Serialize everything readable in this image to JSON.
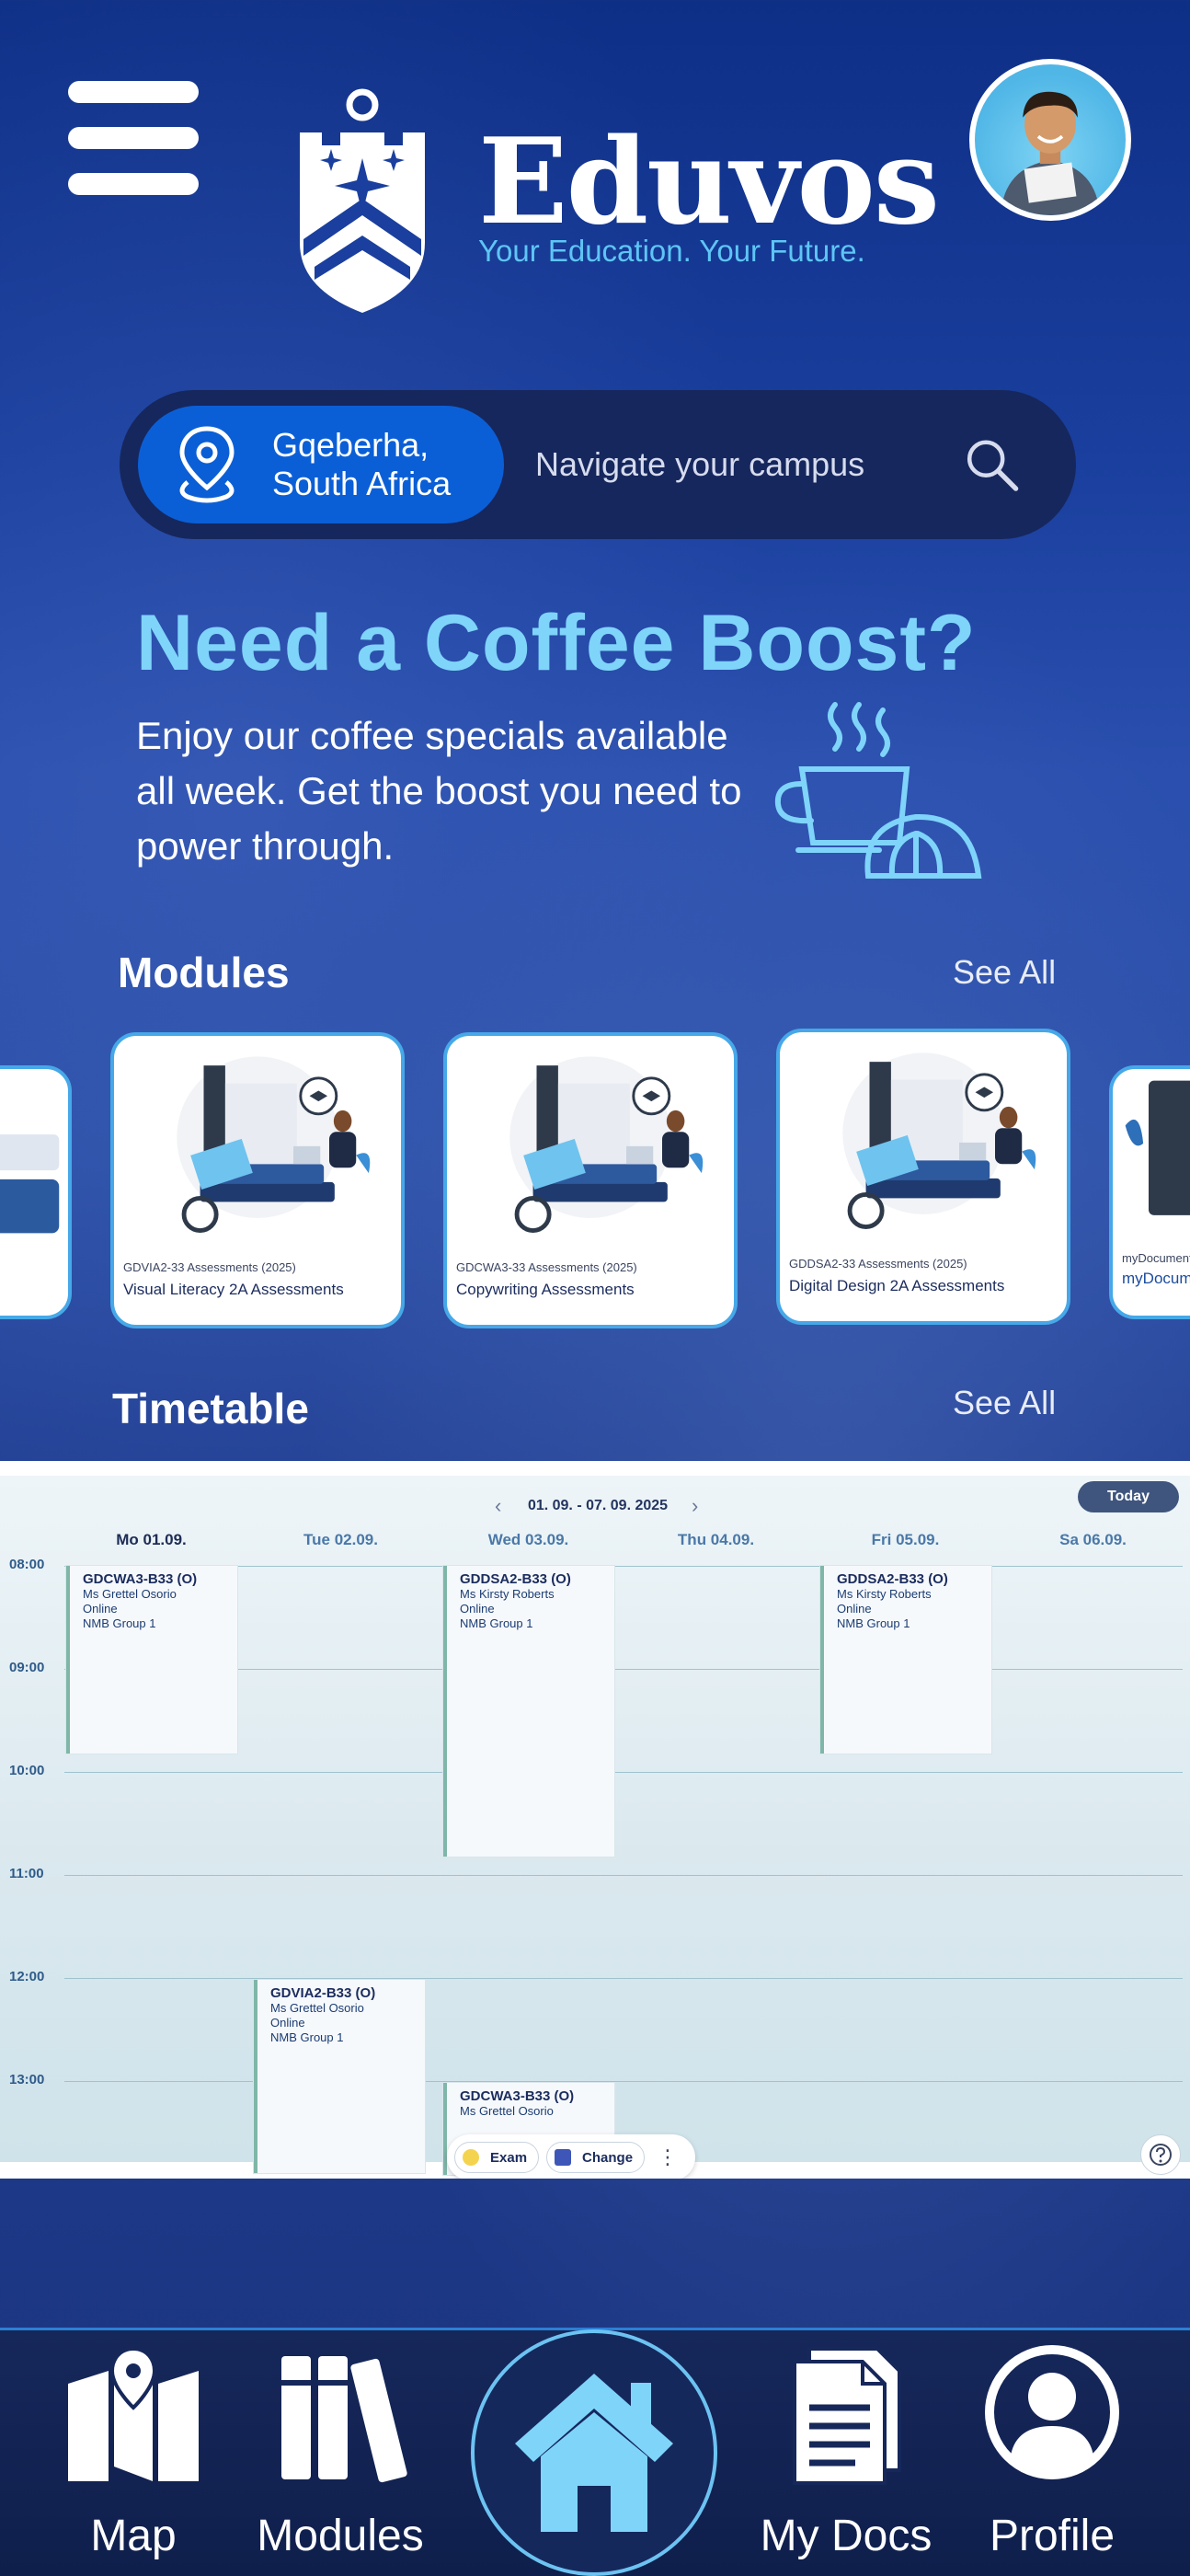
{
  "header": {
    "brand_name": "Eduvos",
    "tagline": "Your Education. Your Future."
  },
  "search": {
    "location_line1": "Gqeberha,",
    "location_line2": "South Africa",
    "placeholder": "Navigate your campus"
  },
  "promo": {
    "title": "Need a Coffee Boost?",
    "text": "Enjoy our coffee specials available all week. Get the boost you need to power through."
  },
  "modules": {
    "title": "Modules",
    "see_all": "See All",
    "cards": [
      {
        "code": "",
        "name": ""
      },
      {
        "code": "GDVIA2-33 Assessments (2025)",
        "name": "Visual Literacy 2A Assessments"
      },
      {
        "code": "GDCWA3-33 Assessments (2025)",
        "name": "Copywriting Assessments"
      },
      {
        "code": "GDDSA2-33 Assessments (2025)",
        "name": "Digital Design 2A Assessments"
      },
      {
        "code": "myDocuments",
        "name": "myDocumen"
      }
    ]
  },
  "timetable": {
    "title": "Timetable",
    "see_all": "See All",
    "range": "01. 09. - 07. 09. 2025",
    "today_label": "Today",
    "days": [
      "Mo 01.09.",
      "Tue 02.09.",
      "Wed 03.09.",
      "Thu 04.09.",
      "Fri 05.09.",
      "Sa 06.09."
    ],
    "hours": [
      "08:00",
      "09:00",
      "10:00",
      "11:00",
      "12:00",
      "13:00"
    ],
    "events": [
      {
        "code": "GDCWA3-B33 (O)",
        "lecturer": "Ms Grettel Osorio",
        "mode": "Online",
        "group": "NMB Group 1"
      },
      {
        "code": "GDDSA2-B33 (O)",
        "lecturer": "Ms Kirsty Roberts",
        "mode": "Online",
        "group": "NMB Group 1"
      },
      {
        "code": "GDDSA2-B33 (O)",
        "lecturer": "Ms Kirsty Roberts",
        "mode": "Online",
        "group": "NMB Group 1"
      },
      {
        "code": "GDVIA2-B33 (O)",
        "lecturer": "Ms Grettel Osorio",
        "mode": "Online",
        "group": "NMB Group 1"
      },
      {
        "code": "GDCWA3-B33 (O)",
        "lecturer": "Ms Grettel Osorio",
        "mode": "",
        "group": ""
      }
    ],
    "legend": {
      "exam": "Exam",
      "change": "Change"
    }
  },
  "bottom_nav": {
    "map": "Map",
    "modules": "Modules",
    "docs": "My Docs",
    "profile": "Profile"
  },
  "colors": {
    "accent": "#7fd4fa",
    "chip": "#0b5fd6",
    "bar": "#16275d"
  }
}
